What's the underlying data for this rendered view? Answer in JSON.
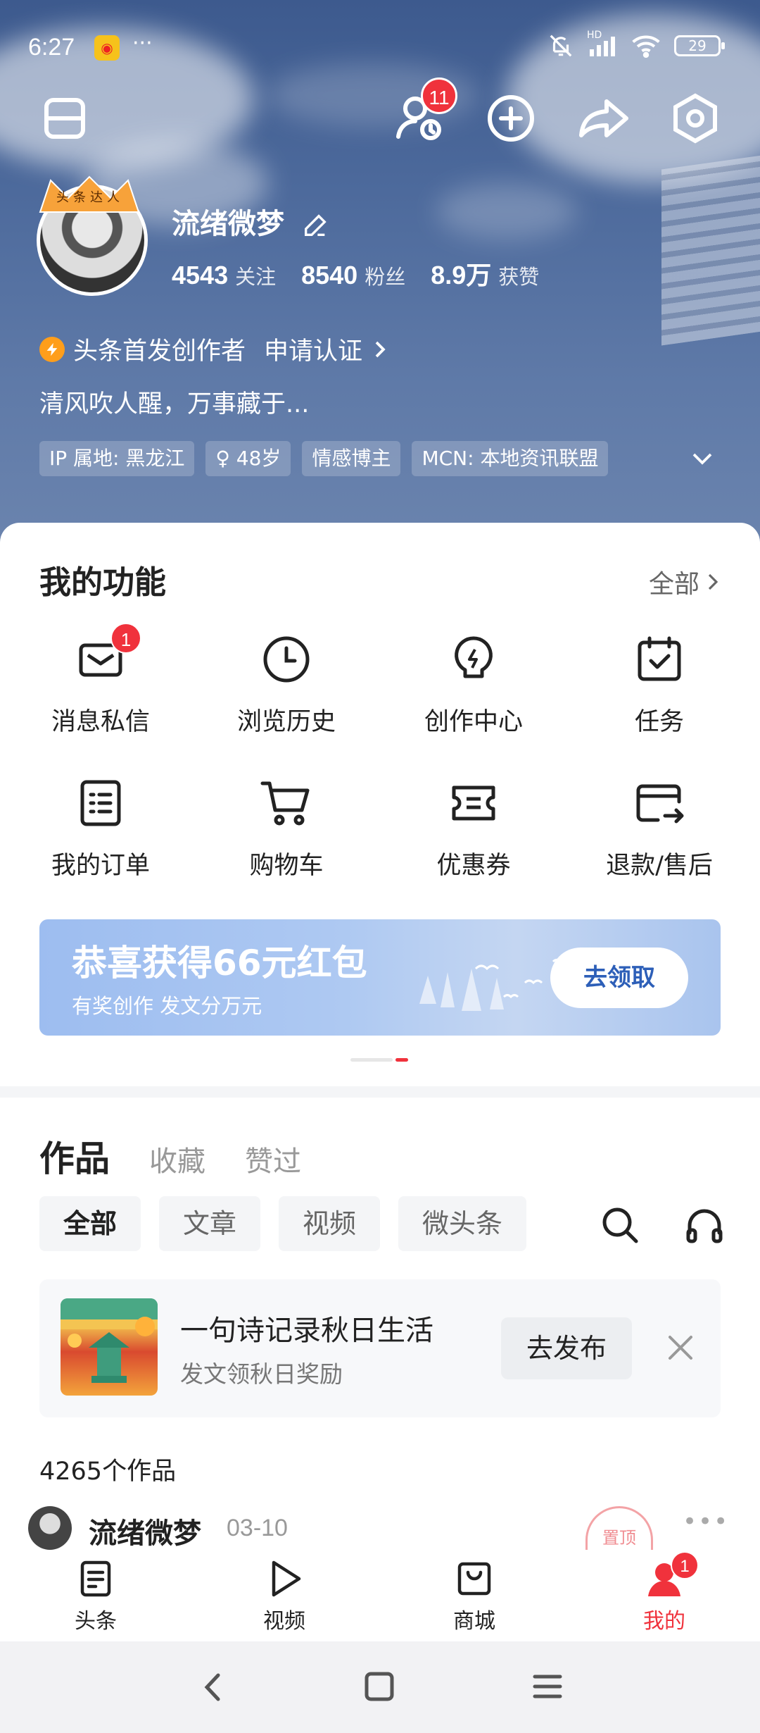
{
  "status": {
    "time": "6:27",
    "network_label": "HD",
    "battery": "29"
  },
  "header": {
    "notification_count": "11"
  },
  "profile": {
    "avatar_crown_text": "头条达人",
    "name": "流绪微梦",
    "stats": [
      {
        "value": "4543",
        "label": "关注"
      },
      {
        "value": "8540",
        "label": "粉丝"
      },
      {
        "value": "8.9万",
        "label": "获赞"
      }
    ],
    "creator_label": "头条首发创作者",
    "verify_label": "申请认证",
    "bio": "清风吹人醒，万事藏于...",
    "tags": [
      "IP 属地: 黑龙江",
      "♀ 48岁",
      "情感博主",
      "MCN: 本地资讯联盟"
    ]
  },
  "functions": {
    "title": "我的功能",
    "all_label": "全部",
    "items": [
      {
        "label": "消息私信",
        "badge": "1",
        "icon": "mail-icon"
      },
      {
        "label": "浏览历史",
        "icon": "clock-icon"
      },
      {
        "label": "创作中心",
        "icon": "bulb-icon"
      },
      {
        "label": "任务",
        "icon": "calendar-check-icon"
      },
      {
        "label": "我的订单",
        "icon": "order-list-icon"
      },
      {
        "label": "购物车",
        "icon": "cart-icon"
      },
      {
        "label": "优惠券",
        "icon": "coupon-icon"
      },
      {
        "label": "退款/售后",
        "icon": "refund-icon"
      }
    ]
  },
  "banner": {
    "title": "恭喜获得66元红包",
    "subtitle": "有奖创作 发文分万元",
    "button": "去领取"
  },
  "works": {
    "tabs": [
      "作品",
      "收藏",
      "赞过"
    ],
    "filters": [
      "全部",
      "文章",
      "视频",
      "微头条"
    ],
    "promo": {
      "title": "一句诗记录秋日生活",
      "subtitle": "发文领秋日奖励",
      "button": "去发布"
    },
    "count_label": "4265个作品",
    "post": {
      "author": "流绪微梦",
      "date": "03-10",
      "stamp": "置顶"
    }
  },
  "tabbar": {
    "items": [
      {
        "label": "头条",
        "icon": "news-icon"
      },
      {
        "label": "视频",
        "icon": "play-icon"
      },
      {
        "label": "商城",
        "icon": "shop-bag-icon"
      },
      {
        "label": "我的",
        "icon": "profile-icon",
        "badge": "1"
      }
    ],
    "active": "我的"
  },
  "colors": {
    "accent_red": "#f0323c",
    "hero_blue": "#4d6a9c",
    "banner_blue": "#9dbdf0",
    "creator_orange": "#ff9e1b"
  }
}
